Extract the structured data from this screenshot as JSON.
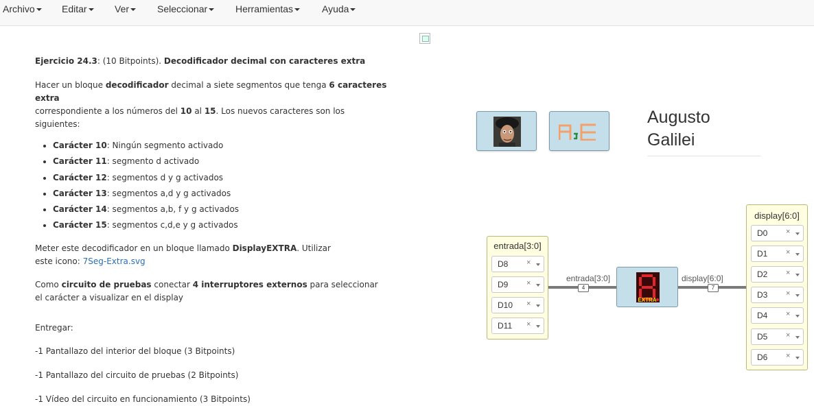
{
  "menu": {
    "items": [
      {
        "label": "Archivo"
      },
      {
        "label": "Editar"
      },
      {
        "label": "Ver"
      },
      {
        "label": "Seleccionar"
      },
      {
        "label": "Herramientas"
      },
      {
        "label": "Ayuda"
      }
    ]
  },
  "doc": {
    "heading_a": "Ejercicio 24.3",
    "heading_b": ": (10 Bitpoints). ",
    "heading_c": "Decodificador decimal con caracteres extra",
    "p1_a": "Hacer un bloque ",
    "p1_b": "decodificador",
    "p1_c": " decimal a siete segmentos que tenga ",
    "p1_d": "6 caracteres extra",
    "p1_e": "correspondiente a los números del ",
    "p1_f": "10",
    "p1_g": " al ",
    "p1_h": "15",
    "p1_i": ". Los nuevos caracteres son los",
    "p1_j": "siguientes:",
    "chars": [
      {
        "name": "Carácter 10",
        "desc": ": Ningún segmento activado"
      },
      {
        "name": "Carácter 11",
        "desc": ": segmento d activado"
      },
      {
        "name": "Carácter 12",
        "desc": ": segmentos d y g activados"
      },
      {
        "name": "Carácter 13",
        "desc": ": segmentos a,d y g activados"
      },
      {
        "name": "Carácter 14",
        "desc": ": segmentos a,b, f y g activados"
      },
      {
        "name": "Carácter 15",
        "desc": ": segmentos c,d,e y g activados"
      }
    ],
    "p2_a": "Meter este decodificador en un bloque llamado ",
    "p2_b": "DisplayEXTRA",
    "p2_c": ". Utilizar",
    "p2_d": "este icono: ",
    "p2_link": "7Seg-Extra.svg",
    "p3_a": "Como ",
    "p3_b": "circuito de pruebas",
    "p3_c": " conectar ",
    "p3_d": "4 interruptores externos",
    "p3_e": " para seleccionar",
    "p3_f": "el carácter a visualizar en el display",
    "entregar": "Entregar:",
    "deliverables": [
      "-1 Pantallazo del interior del bloque (3 Bitpoints)",
      "-1 Pantallazo del circuito de pruebas (2 Bitpoints)",
      "-1 Vídeo del circuito en funcionamiento (3 Bitpoints)"
    ]
  },
  "author": {
    "first": "Augusto",
    "last": "Galilei"
  },
  "circuit": {
    "input_panel": {
      "title": "entrada[3:0]",
      "pins": [
        "D8",
        "D9",
        "D10",
        "D11"
      ]
    },
    "output_panel": {
      "title": "display[6:0]",
      "pins": [
        "D0",
        "D1",
        "D2",
        "D3",
        "D4",
        "D5",
        "D6"
      ]
    },
    "input_wire_label": "entrada[3:0]",
    "input_bus_width": "4",
    "output_wire_label": "display[6:0]",
    "output_bus_width": "7",
    "block_badge": "EXTRA",
    "block_digit_color": "#e0262b",
    "block_badge_color": "#f5d90a"
  },
  "ui": {
    "clear_glyph": "×"
  }
}
